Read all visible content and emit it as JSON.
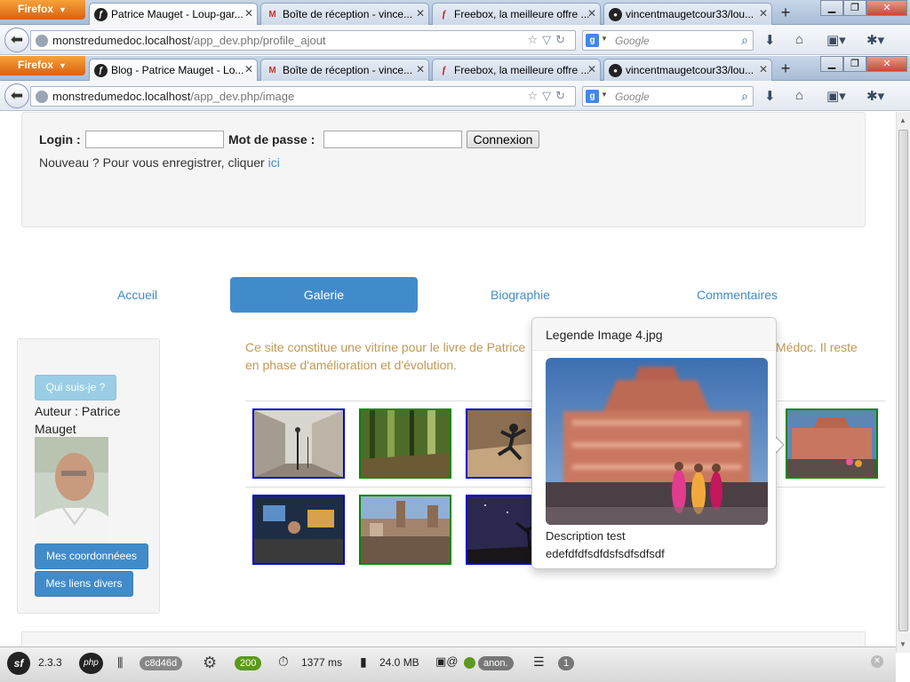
{
  "browser": {
    "firefox_label": "Firefox",
    "windows": [
      {
        "tabs": [
          {
            "label": "Patrice Mauget - Loup-gar...",
            "icon": "symfony-icon",
            "active": true
          },
          {
            "label": "Boîte de réception - vince...",
            "icon": "gmail-icon"
          },
          {
            "label": "Freebox, la meilleure offre ...",
            "icon": "freebox-icon"
          },
          {
            "label": "vincentmaugetcour33/lou...",
            "icon": "github-icon"
          }
        ],
        "url_host": "monstredumedoc.localhost",
        "url_path": "/app_dev.php/profile_ajout"
      },
      {
        "tabs": [
          {
            "label": "Blog - Patrice Mauget - Lo...",
            "icon": "symfony-icon",
            "active": true
          },
          {
            "label": "Boîte de réception - vince...",
            "icon": "gmail-icon"
          },
          {
            "label": "Freebox, la meilleure offre ...",
            "icon": "freebox-icon"
          },
          {
            "label": "vincentmaugetcour33/lou...",
            "icon": "github-icon"
          }
        ],
        "url_host": "monstredumedoc.localhost",
        "url_path": "/app_dev.php/image"
      }
    ],
    "search_placeholder": "Google"
  },
  "login": {
    "login_label": "Login :",
    "password_label": "Mot de passe :",
    "submit_label": "Connexion",
    "register_text": "Nouveau ? Pour vous enregistrer, cliquer ",
    "register_link": "ici"
  },
  "nav": {
    "items": [
      "Accueil",
      "Galerie",
      "Biographie",
      "Commentaires"
    ],
    "active": "Galerie"
  },
  "sidebar": {
    "who_button": "Qui suis-je ?",
    "author_text": "Auteur : Patrice Mauget",
    "coords_button": "Mes coordonnéees",
    "links_button": "Mes liens divers"
  },
  "intro": {
    "line1_left": "Ce site constitue une vitrine pour le livre de Patrice",
    "line1_right": "Médoc. Il reste",
    "line2": "en phase d'amélioration et d'évolution."
  },
  "gallery": {
    "row1": [
      {
        "subject": "street-lamp",
        "border": "#0000cc"
      },
      {
        "subject": "bamboo-forest",
        "border": "#008800"
      },
      {
        "subject": "jumping-man",
        "border": "#0000cc"
      },
      {
        "subject": "palace",
        "border": "#008800"
      }
    ],
    "row2": [
      {
        "subject": "workshop",
        "border": "#0000cc"
      },
      {
        "subject": "town",
        "border": "#008800"
      },
      {
        "subject": "night-tree",
        "border": "#0000cc"
      }
    ]
  },
  "popover": {
    "title": "Legende Image 4.jpg",
    "description_line1": "Description test",
    "description_line2": "edefdfdfsdfdsfsdfsdfsdf"
  },
  "debug_toolbar": {
    "symfony_version": "2.3.3",
    "token": "c8d46d",
    "status_code": "200",
    "time": "1377 ms",
    "memory": "24.0 MB",
    "user": "anon.",
    "db_queries": "1"
  },
  "colors": {
    "primary": "#428bca",
    "intro_text": "#c09853",
    "status_ok": "#5b9a1b"
  }
}
